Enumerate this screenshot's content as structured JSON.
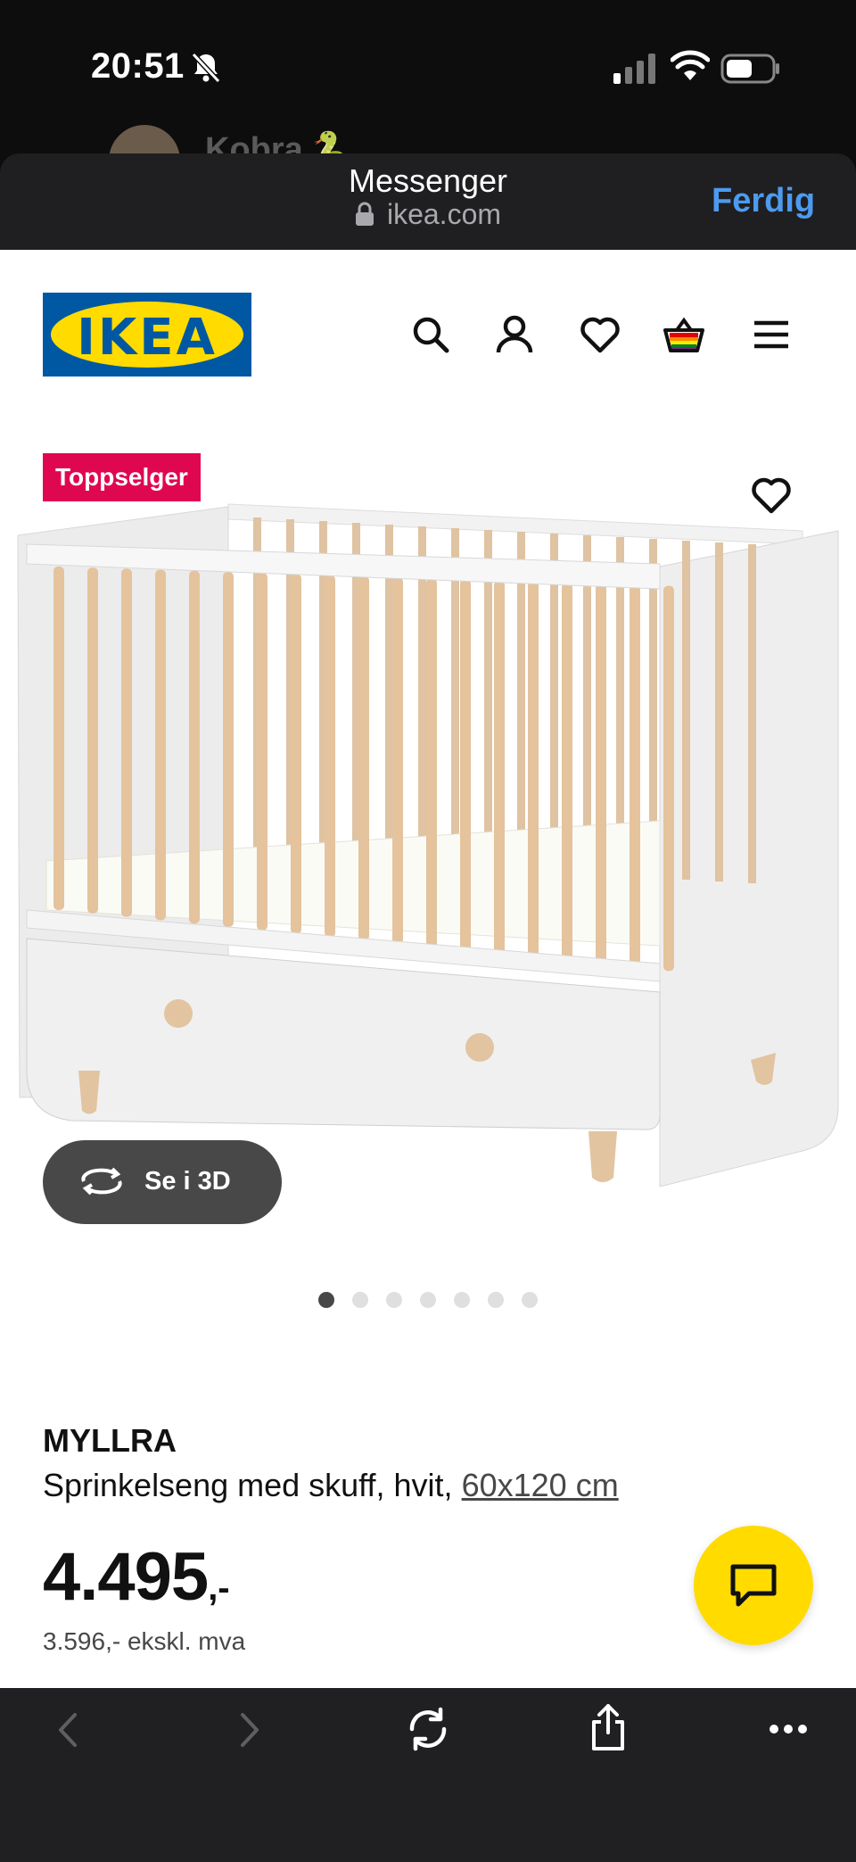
{
  "status_bar": {
    "time": "20:51",
    "icons": [
      "bell-off-icon",
      "signal-icon",
      "wifi-icon",
      "battery-icon"
    ]
  },
  "peek": {
    "name": "Kobra 🐍"
  },
  "browser_header": {
    "title": "Messenger",
    "url": "ikea.com",
    "done_label": "Ferdig"
  },
  "site_header": {
    "logo_text": "IKEA",
    "icons": [
      "search-icon",
      "account-icon",
      "favorites-icon",
      "cart-icon",
      "menu-icon"
    ]
  },
  "product": {
    "badge": "Toppselger",
    "view3d_label": "Se i 3D",
    "carousel": {
      "total": 7,
      "active": 1
    },
    "name": "MYLLRA",
    "description": "Sprinkelseng med skuff, hvit,",
    "size": "60x120 cm",
    "price": "4.495",
    "price_suffix": ",-",
    "price_ex_vat": "3.596,- ekskl. mva"
  },
  "colors": {
    "ikea_blue": "#0058a3",
    "ikea_yellow": "#ffdb00",
    "badge_red": "#e00751",
    "link_blue": "#4c9bf0"
  },
  "bottom_toolbar": {
    "icons": [
      "back-icon",
      "forward-icon",
      "reload-icon",
      "share-icon",
      "more-icon"
    ]
  }
}
